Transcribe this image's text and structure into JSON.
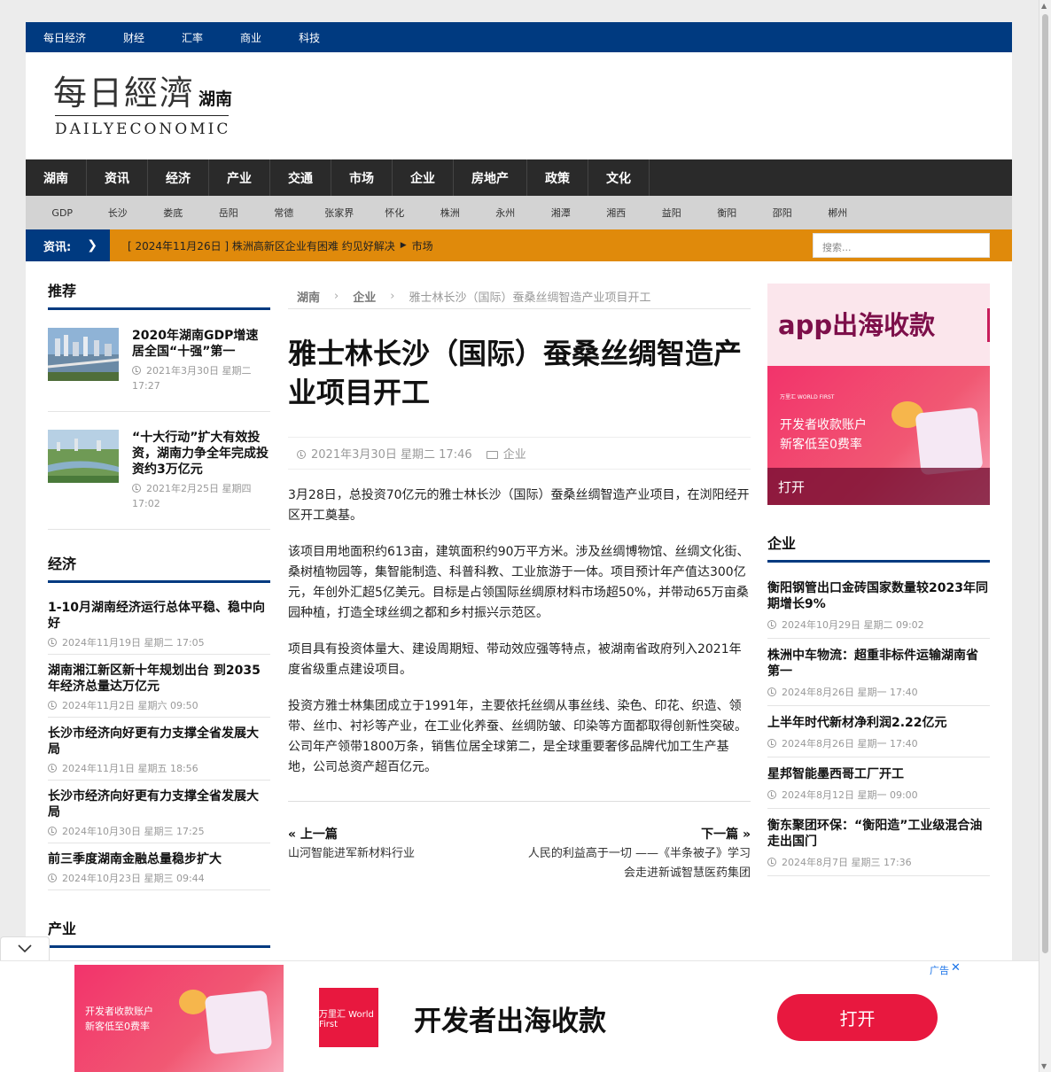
{
  "topbar": [
    "每日经济",
    "财经",
    "汇率",
    "商业",
    "科技"
  ],
  "logo": {
    "cn": "每日經濟",
    "province": "湖南",
    "en": "DAILYECONOMIC"
  },
  "mainnav": [
    "湖南",
    "资讯",
    "经济",
    "产业",
    "交通",
    "市场",
    "企业",
    "房地产",
    "政策",
    "文化"
  ],
  "subnav": [
    "GDP",
    "长沙",
    "娄底",
    "岳阳",
    "常德",
    "张家界",
    "怀化",
    "株洲",
    "永州",
    "湘潭",
    "湘西",
    "益阳",
    "衡阳",
    "邵阳",
    "郴州"
  ],
  "ticker": {
    "label": "资讯:",
    "date": "[ 2024年11月26日 ]",
    "headline": "株洲高新区企业有困难 约见好解决",
    "category": "市场",
    "search_placeholder": "搜索..."
  },
  "left": {
    "rec_title": "推荐",
    "rec": [
      {
        "title": "2020年湖南GDP增速居全国“十强”第一",
        "date": "2021年3月30日 星期二 17:27"
      },
      {
        "title": "“十大行动”扩大有效投资，湖南力争全年完成投资约3万亿元",
        "date": "2021年2月25日 星期四 17:02"
      }
    ],
    "econ_title": "经济",
    "econ": [
      {
        "title": "1-10月湖南经济运行总体平稳、稳中向好",
        "date": "2024年11月19日 星期二 17:05"
      },
      {
        "title": "湖南湘江新区新十年规划出台 到2035年经济总量达万亿元",
        "date": "2024年11月2日 星期六 09:50"
      },
      {
        "title": "长沙市经济向好更有力支撑全省发展大局",
        "date": "2024年11月1日 星期五 18:56"
      },
      {
        "title": "长沙市经济向好更有力支撑全省发展大局",
        "date": "2024年10月30日 星期三 17:25"
      },
      {
        "title": "前三季度湖南金融总量稳步扩大",
        "date": "2024年10月23日 星期三 09:44"
      }
    ],
    "industry_title": "产业"
  },
  "article": {
    "crumb": [
      "湖南",
      "企业",
      "雅士林长沙（国际）蚕桑丝绸智造产业项目开工"
    ],
    "title": "雅士林长沙（国际）蚕桑丝绸智造产业项目开工",
    "date": "2021年3月30日 星期二 17:46",
    "category": "企业",
    "paragraphs": [
      "3月28日，总投资70亿元的雅士林长沙（国际）蚕桑丝绸智造产业项目，在浏阳经开区开工奠基。",
      "该项目用地面积约613亩，建筑面积约90万平方米。涉及丝绸博物馆、丝绸文化街、桑树植物园等，集智能制造、科普科教、工业旅游于一体。项目预计年产值达300亿元，年创外汇超5亿美元。目标是占领国际丝绸原材料市场超50%，并带动65万亩桑园种植，打造全球丝绸之都和乡村振兴示范区。",
      "项目具有投资体量大、建设周期短、带动效应强等特点，被湖南省政府列入2021年度省级重点建设项目。",
      "投资方雅士林集团成立于1991年，主要依托丝绸从事丝线、染色、印花、织造、领带、丝巾、衬衫等产业，在工业化养蚕、丝绸防皱、印染等方面都取得创新性突破。公司年产领带1800万条，销售位居全球第二，是全球重要奢侈品牌代加工生产基地，公司总资产超百亿元。"
    ],
    "prev_label": "« 上一篇",
    "prev_link": "山河智能进军新材料行业",
    "next_label": "下一篇 »",
    "next_link": "人民的利益高于一切 ——《半条被子》学习会走进新诚智慧医药集团"
  },
  "right": {
    "ad_headline": "app出海收款",
    "ad_line1": "开发者收款账户",
    "ad_line2": "新客低至0费率",
    "ad_brand": "万里汇 WORLD FIRST",
    "ad_open": "打开",
    "section_title": "企业",
    "items": [
      {
        "title": "衡阳钢管出口金砖国家数量较2023年同期增长9%",
        "date": "2024年10月29日 星期二 09:02"
      },
      {
        "title": "株洲中车物流：超重非标件运输湖南省第一",
        "date": "2024年8月26日 星期一 17:40"
      },
      {
        "title": "上半年时代新材净利润2.22亿元",
        "date": "2024年8月26日 星期一 17:40"
      },
      {
        "title": "星邦智能墨西哥工厂开工",
        "date": "2024年8月12日 星期一 09:00"
      },
      {
        "title": "衡东聚团环保：“衡阳造”工业级混合油走出国门",
        "date": "2024年8月7日 星期三 17:36"
      }
    ]
  },
  "bottom_ad": {
    "line1": "开发者收款账户",
    "line2": "新客低至0费率",
    "logo": "万里汇 World First",
    "slogan": "开发者出海收款",
    "button": "打开",
    "tag": "广告"
  },
  "colors": {
    "navy": "#003a80",
    "orange": "#e08a0b",
    "dark_nav": "#2a2a2a",
    "ad_red": "#e8183f"
  }
}
